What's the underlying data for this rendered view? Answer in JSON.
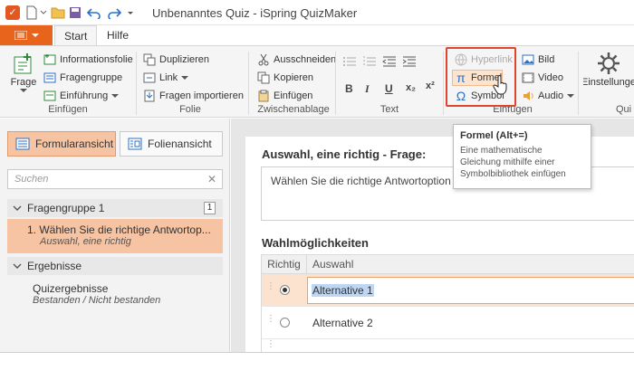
{
  "window": {
    "title": "Unbenanntes Quiz - iSpring QuizMaker"
  },
  "ribbon_tabs": {
    "file": "",
    "start": "Start",
    "help": "Hilfe"
  },
  "ribbon": {
    "frage": "Frage",
    "informationsfolie": "Informationsfolie",
    "fragengruppe": "Fragengruppe",
    "einfuehrung": "Einführung",
    "duplizieren": "Duplizieren",
    "link": "Link",
    "fragen_importieren": "Fragen importieren",
    "ausschneiden": "Ausschneiden",
    "kopieren": "Kopieren",
    "einfuegen_clip": "Einfügen",
    "hyperlink": "Hyperlink",
    "formel": "Formel",
    "symbol": "Symbol",
    "bild": "Bild",
    "video": "Video",
    "audio": "Audio",
    "einstellungen": "Einstellunge",
    "groups": {
      "einfuegen": "Einfügen",
      "folie": "Folie",
      "zwischenablage": "Zwischenablage",
      "text": "Text",
      "einfuegen2": "Einfügen",
      "quiz": "Qui"
    },
    "format": {
      "bold": "B",
      "italic": "I",
      "underline": "U",
      "sub": "x₂",
      "sup": "x²"
    }
  },
  "tooltip": {
    "title": "Formel (Alt+=)",
    "body": "Eine mathematische Gleichung mithilfe einer Symbolbibliothek einfügen"
  },
  "left_pane": {
    "view_form": "Formularansicht",
    "view_slide": "Folienansicht",
    "search_placeholder": "Suchen",
    "group1": "Fragengruppe 1",
    "group1_count": "1",
    "item1_title": "1. Wählen Sie die richtige Antwortop...",
    "item1_sub": "Auswahl, eine richtig",
    "results": "Ergebnisse",
    "results_item": "Quizergebnisse",
    "results_sub": "Bestanden / Nicht bestanden"
  },
  "editor": {
    "question_header": "Auswahl, eine richtig - Frage:",
    "question_text": "Wählen Sie die richtige Antwortoption",
    "choices_header": "Wahlmöglichkeiten",
    "col_correct": "Richtig",
    "col_choice": "Auswahl",
    "choices": [
      {
        "label": "Alternative 1",
        "correct": true
      },
      {
        "label": "Alternative 2",
        "correct": false
      }
    ]
  },
  "colors": {
    "accent": "#e8631c",
    "selection": "#f6c4a3",
    "highlight_frame": "#e0452d"
  }
}
